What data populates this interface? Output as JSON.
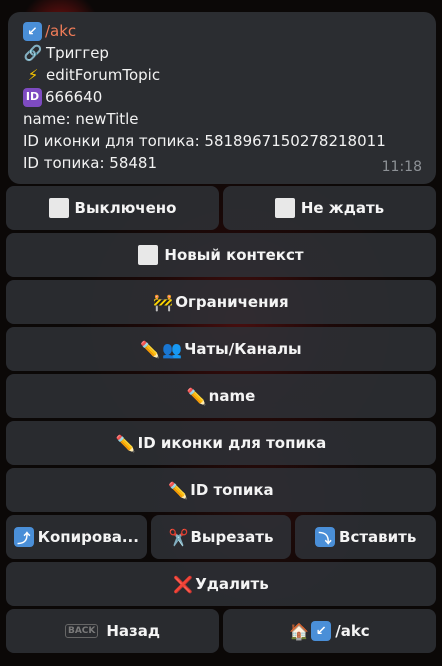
{
  "message": {
    "command": "/akc",
    "trigger": "Триггер",
    "event": "editForumTopic",
    "id_value": "666640",
    "name_line": "name: newTitle",
    "icon_id_line": "ID иконки для топика: 5818967150278218011",
    "topic_id_line": "ID топика: 58481",
    "time": "11:18",
    "icons": {
      "command": "arrow-down-left-icon",
      "trigger": "link-icon",
      "event": "lightning-icon",
      "id": "id-badge-icon"
    }
  },
  "keyboard": {
    "disabled": "Выключено",
    "no_wait": "Не ждать",
    "new_context": "Новый контекст",
    "limits": "Ограничения",
    "chats": "Чаты/Каналы",
    "name": "name",
    "icon_id": "ID иконки для топика",
    "topic_id": "ID топика",
    "copy": "Копирова...",
    "cut": "Вырезать",
    "paste": "Вставить",
    "delete": "Удалить",
    "back": "Назад",
    "home": "/akc",
    "back_icon_text": "BACK"
  },
  "colors": {
    "bubble": "#2b2d31",
    "button": "#2e3035",
    "link": "#f07c58",
    "accent_blue": "#4a8fd8"
  }
}
